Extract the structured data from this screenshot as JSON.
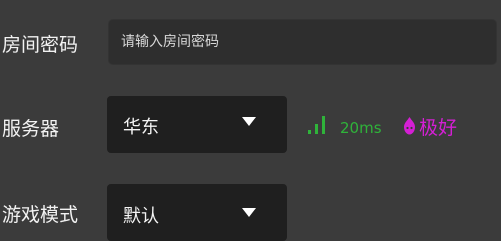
{
  "room_password": {
    "label": "房间密码",
    "placeholder": "请输入房间密码",
    "value": ""
  },
  "server": {
    "label": "服务器",
    "selected": "华东",
    "latency": "20ms",
    "quality": "极好",
    "signal_icon": "signal-strength-icon",
    "latency_color": "#2fb33a",
    "quality_color": "#d41fd4"
  },
  "game_mode": {
    "label": "游戏模式",
    "selected": "默认"
  }
}
